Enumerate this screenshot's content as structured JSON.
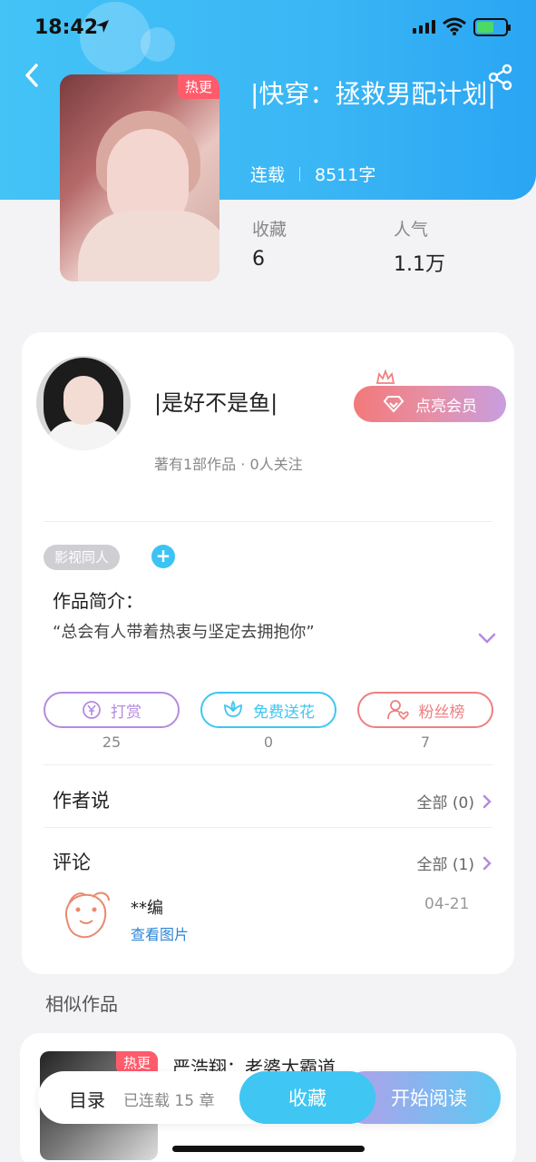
{
  "status_bar": {
    "time": "18:42"
  },
  "book": {
    "title": "|快穿：拯救男配计划|",
    "badge": "热更",
    "status": "连载",
    "word_count": "8511字",
    "stats": [
      {
        "label": "收藏",
        "value": "6"
      },
      {
        "label": "人气",
        "value": "1.1万"
      }
    ]
  },
  "author": {
    "name": "|是好不是鱼|",
    "subtitle": "著有1部作品 · 0人关注",
    "vip_button": "点亮会员"
  },
  "tag": "影视同人",
  "intro": {
    "label": "作品简介：",
    "text": "“总会有人带着热衷与坚定去拥抱你”"
  },
  "actions": [
    {
      "label": "打赏",
      "count": "25",
      "color": "#b58ae0"
    },
    {
      "label": "免费送花",
      "count": "0",
      "color": "#3fc6f2"
    },
    {
      "label": "粉丝榜",
      "count": "7",
      "color": "#ef7f7f"
    }
  ],
  "author_says": {
    "label": "作者说",
    "right": "全部 (0)"
  },
  "comments": {
    "label": "评论",
    "right": "全部 (1)",
    "items": [
      {
        "user": "**编",
        "date": "04-21",
        "link": "查看图片"
      }
    ]
  },
  "similar": {
    "title": "相似作品",
    "items": [
      {
        "title": "严浩翔：老婆太霸道",
        "badge": "热更"
      }
    ]
  },
  "bottom_bar": {
    "toc": "目录",
    "serial": "已连载 15 章",
    "favorite": "收藏",
    "read": "开始阅读"
  },
  "colors": {
    "header_blue": "#3ab6f5",
    "hot_badge": "#ff5b6b",
    "accent_cyan": "#3fc6f2"
  }
}
